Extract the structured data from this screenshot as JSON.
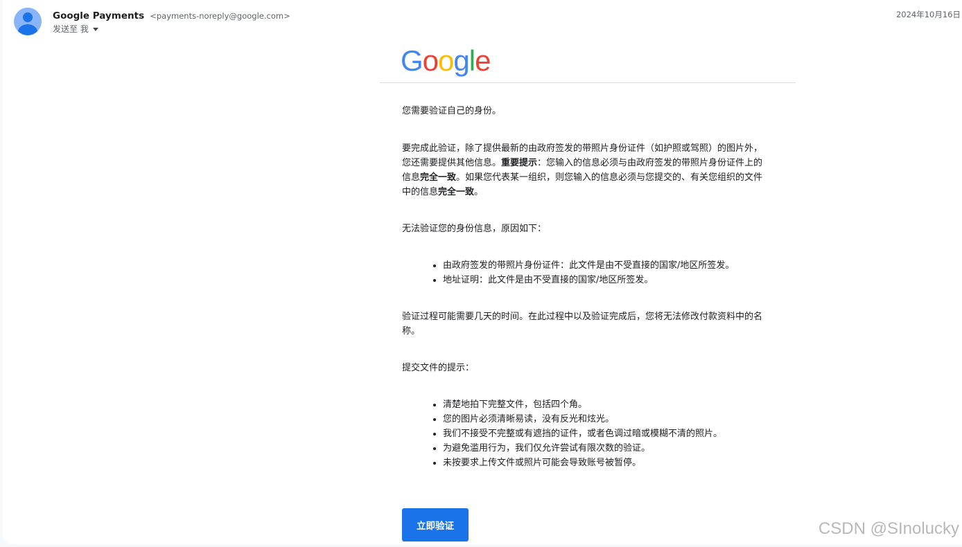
{
  "header": {
    "sender_name": "Google Payments",
    "sender_email": "<payments-noreply@google.com>",
    "recipient": "发送至 我",
    "date": "2024年10月16日"
  },
  "logo": {
    "letters": [
      "G",
      "o",
      "o",
      "g",
      "l",
      "e"
    ],
    "colors": [
      "#4285F4",
      "#EA4335",
      "#FBBC05",
      "#4285F4",
      "#34A853",
      "#EA4335"
    ]
  },
  "body": {
    "intro": "您需要验证自己的身份。",
    "para1_a": "要完成此验证，除了提供最新的由政府签发的带照片身份证件（如护照或驾照）的图片外，您还需要提供其他信息。",
    "para1_b_bold": "重要提示",
    "para1_c": "：您输入的信息必须与由政府签发的带照片身份证件上的信息",
    "para1_d_bold": "完全一致",
    "para1_e": "。如果您代表某一组织，则您输入的信息必须与您提交的、有关您组织的文件中的信息",
    "para1_f_bold": "完全一致",
    "para1_g": "。",
    "reasons_title": "无法验证您的身份信息，原因如下：",
    "reasons": [
      "由政府签发的带照片身份证件：此文件是由不受直接的国家/地区所签发。",
      "地址证明：此文件是由不受直接的国家/地区所签发。"
    ],
    "process_note": "验证过程可能需要几天的时间。在此过程中以及验证完成后，您将无法修改付款资料中的名称。",
    "tips_title": "提交文件的提示：",
    "tips": [
      "清楚地拍下完整文件，包括四个角。",
      "您的图片必须清晰易读，没有反光和炫光。",
      "我们不接受不完整或有遮挡的证件，或者色调过暗或模糊不清的照片。",
      "为避免滥用行为，我们仅允许尝试有限次数的验证。",
      "未按要求上传文件或照片可能会导致账号被暂停。"
    ],
    "button_label": "立即验证"
  },
  "watermark": "CSDN @SInolucky"
}
